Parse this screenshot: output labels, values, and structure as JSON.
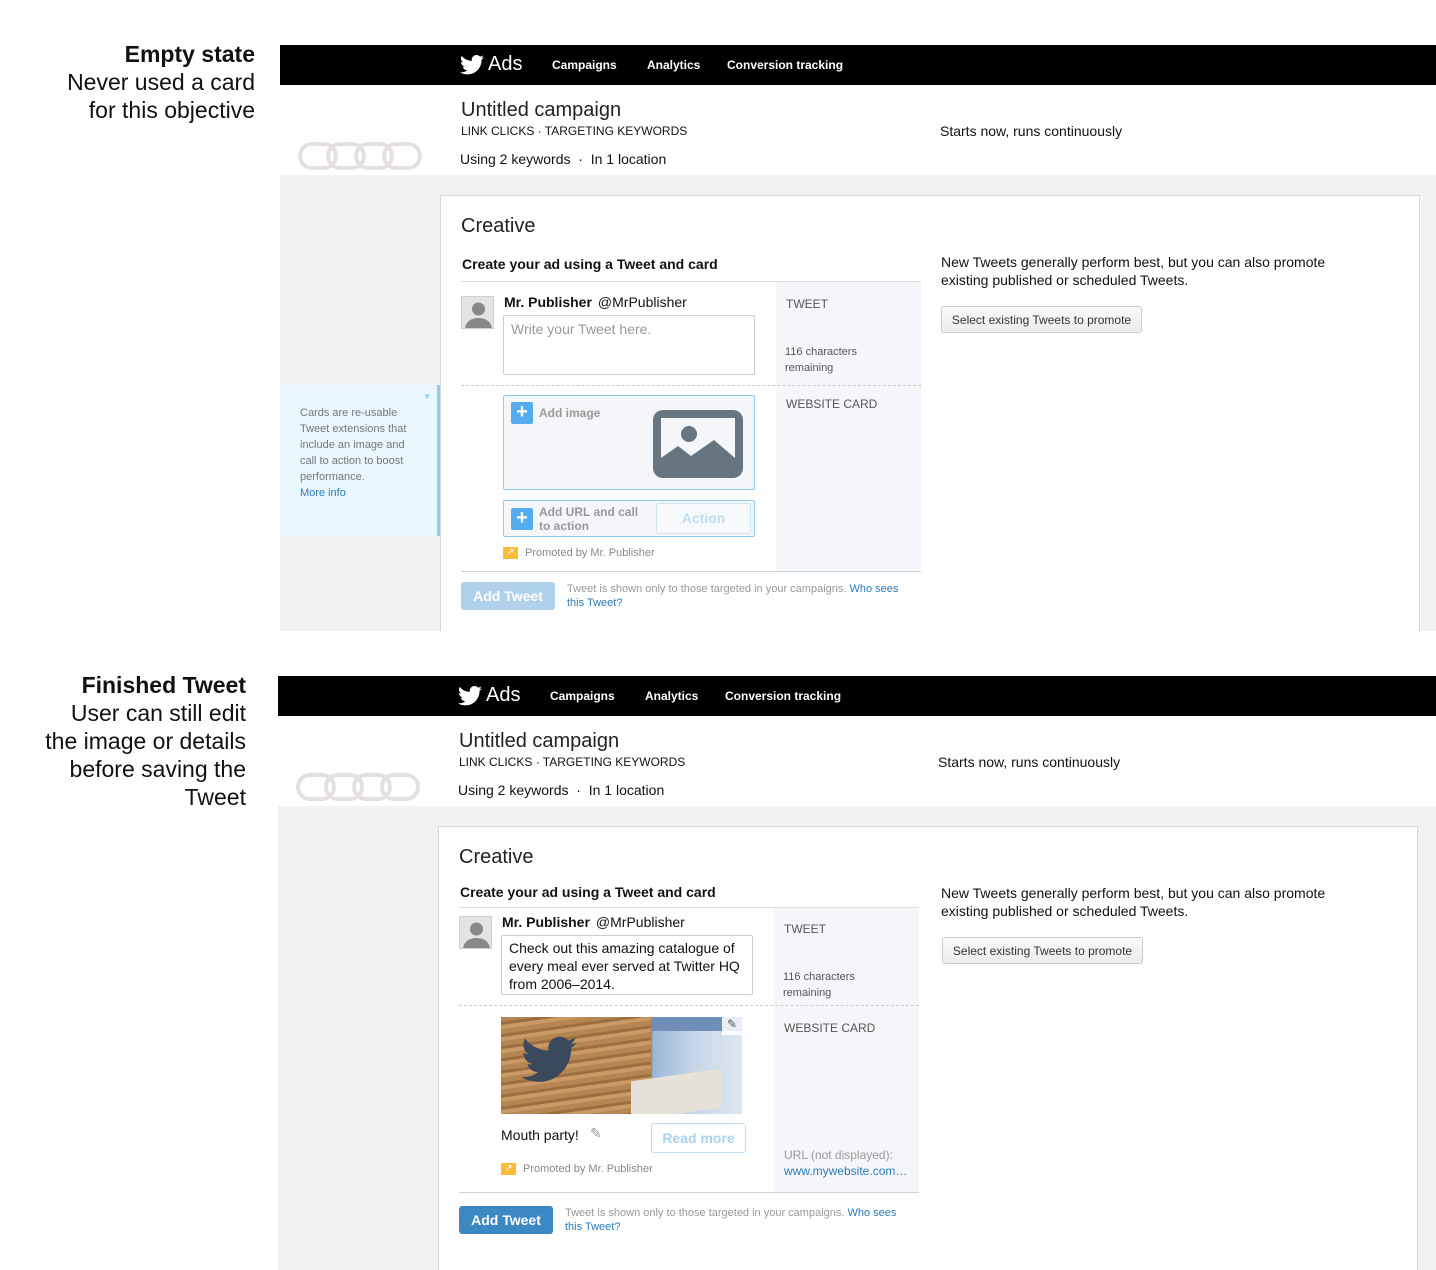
{
  "captions": [
    {
      "title": "Empty state",
      "lines": [
        "Never used a card",
        "for this objective"
      ]
    },
    {
      "title": "Finished Tweet",
      "lines": [
        "User can still edit",
        "the image or details",
        "before saving the",
        "Tweet"
      ]
    }
  ],
  "nav": {
    "logo": "Ads",
    "items": [
      "Campaigns",
      "Analytics",
      "Conversion tracking"
    ]
  },
  "campaign": {
    "title": "Untitled campaign",
    "subtitle": "LINK CLICKS · TARGETING KEYWORDS",
    "keywords": "Using 2 keywords",
    "separator": "·",
    "location": "In 1 location",
    "schedule": "Starts now, runs continuously"
  },
  "creative": {
    "heading": "Creative",
    "subheading": "Create your ad using a Tweet and card",
    "user_name": "Mr. Publisher",
    "user_handle": "@MrPublisher",
    "tweet_label": "TWEET",
    "chars_remaining": "116 characters remaining",
    "card_label": "WEBSITE CARD",
    "promoted": "Promoted by Mr. Publisher",
    "add_tweet": "Add Tweet",
    "note": "Tweet is shown only to those targeted in your campaigns.",
    "note_link": "Who sees this Tweet?",
    "right_text": "New Tweets generally perform best, but you can also promote existing published or scheduled Tweets.",
    "select_existing": "Select existing Tweets to promote"
  },
  "empty": {
    "tweet_placeholder": "Write your Tweet here.",
    "add_image": "Add image",
    "add_url": "Add URL and call to action",
    "action_placeholder": "Action",
    "tooltip": "Cards are re-usable Tweet extensions that include an image and call to action to boost performance.",
    "tooltip_link": "More info",
    "add_tweet_enabled": false
  },
  "finished": {
    "tweet_text": "Check out this amazing catalogue of every meal ever served at Twitter HQ from 2006–2014.",
    "card_title": "Mouth party!",
    "cta": "Read more",
    "url_label": "URL (not displayed):",
    "url": "www.mywebsite.com…",
    "add_tweet_enabled": true
  },
  "colors": {
    "accent": "#55acee",
    "button_active": "#3b88c3",
    "button_disabled": "#b0d1ea",
    "link": "#2b7bb9",
    "tooltip_bg": "#eaf7fe"
  }
}
